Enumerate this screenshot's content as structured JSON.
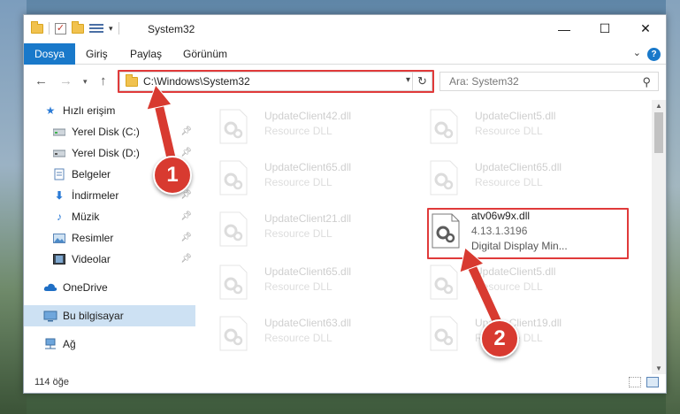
{
  "window": {
    "title": "System32",
    "controls": {
      "minimize": "—",
      "maximize": "☐",
      "close": "✕"
    }
  },
  "ribbon": {
    "tabs": [
      "Dosya",
      "Giriş",
      "Paylaş",
      "Görünüm"
    ],
    "help": "?"
  },
  "address": {
    "path": "C:\\Windows\\System32",
    "search_placeholder": "Ara: System32"
  },
  "sidebar": {
    "items": [
      {
        "label": "Hızlı erişim",
        "icon": "star-icon",
        "pinned": false
      },
      {
        "label": "Yerel Disk (C:)",
        "icon": "drive-icon",
        "pinned": true
      },
      {
        "label": "Yerel Disk (D:)",
        "icon": "drive-icon",
        "pinned": true
      },
      {
        "label": "Belgeler",
        "icon": "documents-icon",
        "pinned": true
      },
      {
        "label": "İndirmeler",
        "icon": "download-icon",
        "pinned": true
      },
      {
        "label": "Müzik",
        "icon": "music-icon",
        "pinned": true
      },
      {
        "label": "Resimler",
        "icon": "pictures-icon",
        "pinned": true
      },
      {
        "label": "Videolar",
        "icon": "videos-icon",
        "pinned": true
      },
      {
        "label": "OneDrive",
        "icon": "cloud-icon",
        "pinned": false
      },
      {
        "label": "Bu bilgisayar",
        "icon": "computer-icon",
        "pinned": false,
        "selected": true
      },
      {
        "label": "Ağ",
        "icon": "network-icon",
        "pinned": false
      }
    ]
  },
  "files": [
    {
      "name": "UpdateClient42.dll",
      "desc": "Resource DLL"
    },
    {
      "name": "UpdateClient5.dll",
      "desc": "Resource DLL"
    },
    {
      "name": "UpdateClient65.dll",
      "desc": "Resource DLL"
    },
    {
      "name": "UpdateClient65.dll",
      "desc": "Resource DLL"
    },
    {
      "name": "UpdateClient21.dll",
      "desc": "Resource DLL"
    },
    {
      "name": "atv06w9x.dll",
      "version": "4.13.1.3196",
      "desc": "Digital Display Min..."
    },
    {
      "name": "UpdateClient65.dll",
      "desc": "Resource DLL"
    },
    {
      "name": "UpdateClient5.dll",
      "desc": "Resource DLL"
    },
    {
      "name": "UpdateClient63.dll",
      "desc": "Resource DLL"
    },
    {
      "name": "UpdateClient19.dll",
      "desc": "Resource DLL"
    }
  ],
  "status": {
    "item_count": "114 öğe"
  },
  "annotations": {
    "badge1": "1",
    "badge2": "2"
  },
  "colors": {
    "accent": "#1979ca",
    "highlight": "#e03a3a",
    "badge": "#d83a30"
  }
}
